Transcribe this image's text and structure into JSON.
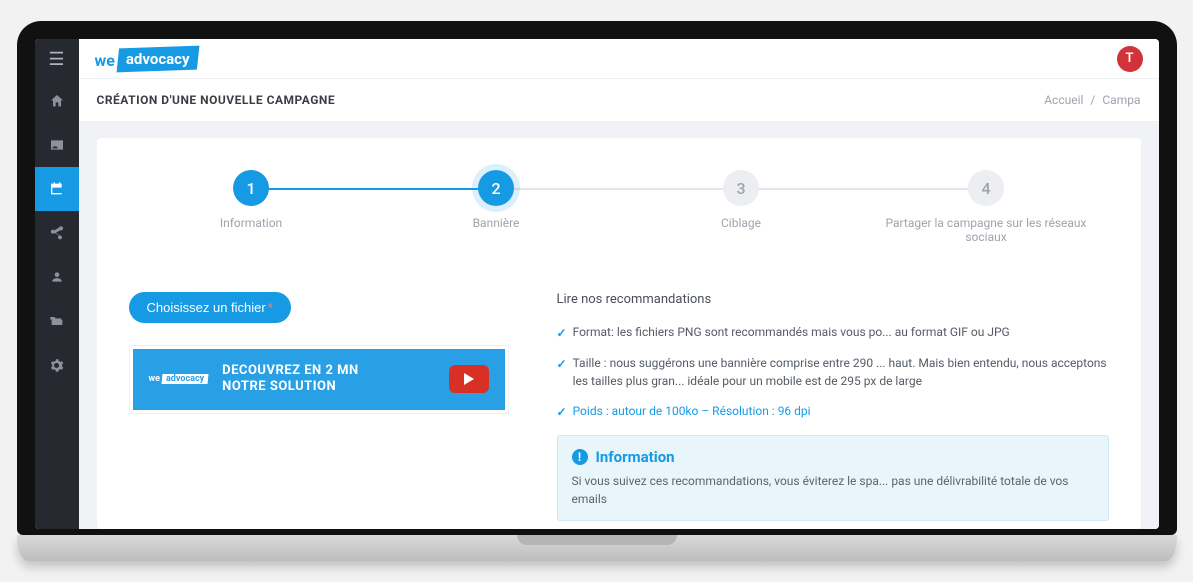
{
  "header": {
    "logo_we": "we",
    "logo_advocacy": "advocacy",
    "avatar_initial": "T"
  },
  "page": {
    "title": "CRÉATION D'UNE NOUVELLE CAMPAGNE",
    "breadcrumbs": {
      "home": "Accueil",
      "current": "Campa"
    }
  },
  "steps": [
    {
      "num": "1",
      "label": "Information",
      "state": "done"
    },
    {
      "num": "2",
      "label": "Bannière",
      "state": "active"
    },
    {
      "num": "3",
      "label": "Ciblage",
      "state": "pending"
    },
    {
      "num": "4",
      "label": "Partager la campagne sur les réseaux sociaux",
      "state": "pending"
    }
  ],
  "upload": {
    "button": "Choisissez un fichier"
  },
  "banner": {
    "mini_we": "we",
    "mini_adv": "advocacy",
    "line1": "DECOUVREZ EN 2 MN",
    "line2": "NOTRE SOLUTION"
  },
  "recommendations": {
    "title": "Lire nos recommandations",
    "items": [
      "Format: les fichiers PNG sont recommandés mais vous po... au format GIF ou JPG",
      "Taille : nous suggérons une bannière comprise entre 290 ... haut. Mais bien entendu, nous acceptons les tailles plus gran... idéale pour un mobile est de 295 px de large",
      "Poids : autour de 100ko – Résolution : 96 dpi"
    ]
  },
  "infobox": {
    "title": "Information",
    "body": "Si vous suivez ces recommandations, vous éviterez le spa... pas une délivrabilité totale de vos emails"
  }
}
